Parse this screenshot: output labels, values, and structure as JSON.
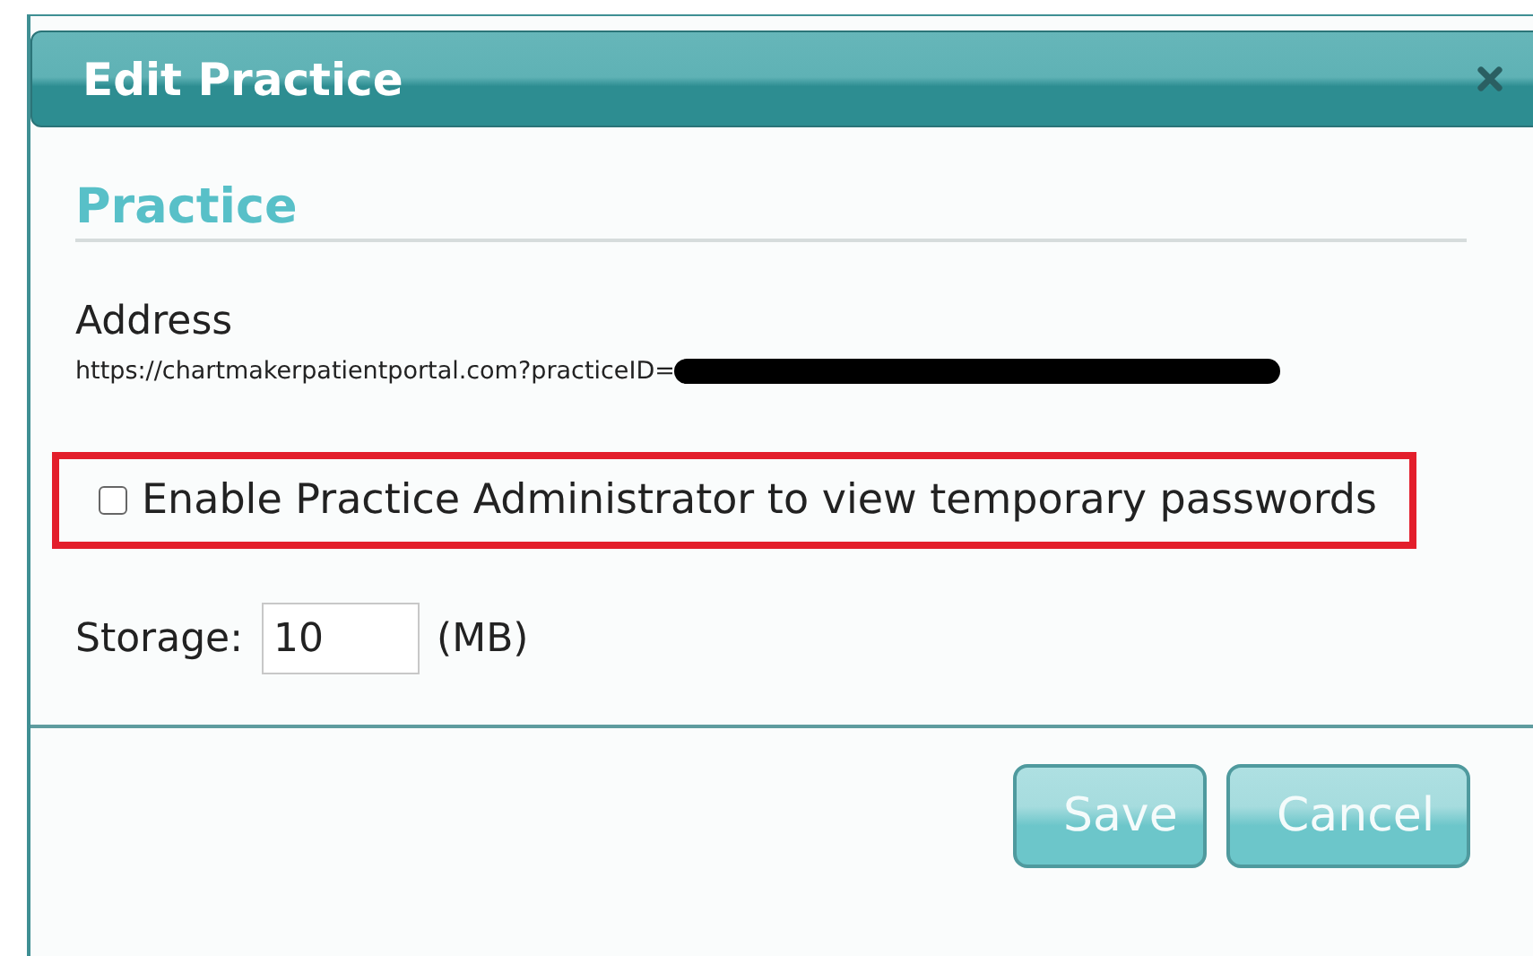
{
  "dialog": {
    "title": "Edit Practice"
  },
  "section": {
    "title": "Practice"
  },
  "address": {
    "label": "Address",
    "value": "https://chartmakerpatientportal.com?practiceID=",
    "redacted": true
  },
  "option": {
    "label": "Enable Practice Administrator to view temporary passwords",
    "checked": false,
    "highlighted": true
  },
  "storage": {
    "label": "Storage:",
    "value": "10",
    "unit": "(MB)"
  },
  "buttons": [
    "Save",
    "Cancel"
  ]
}
